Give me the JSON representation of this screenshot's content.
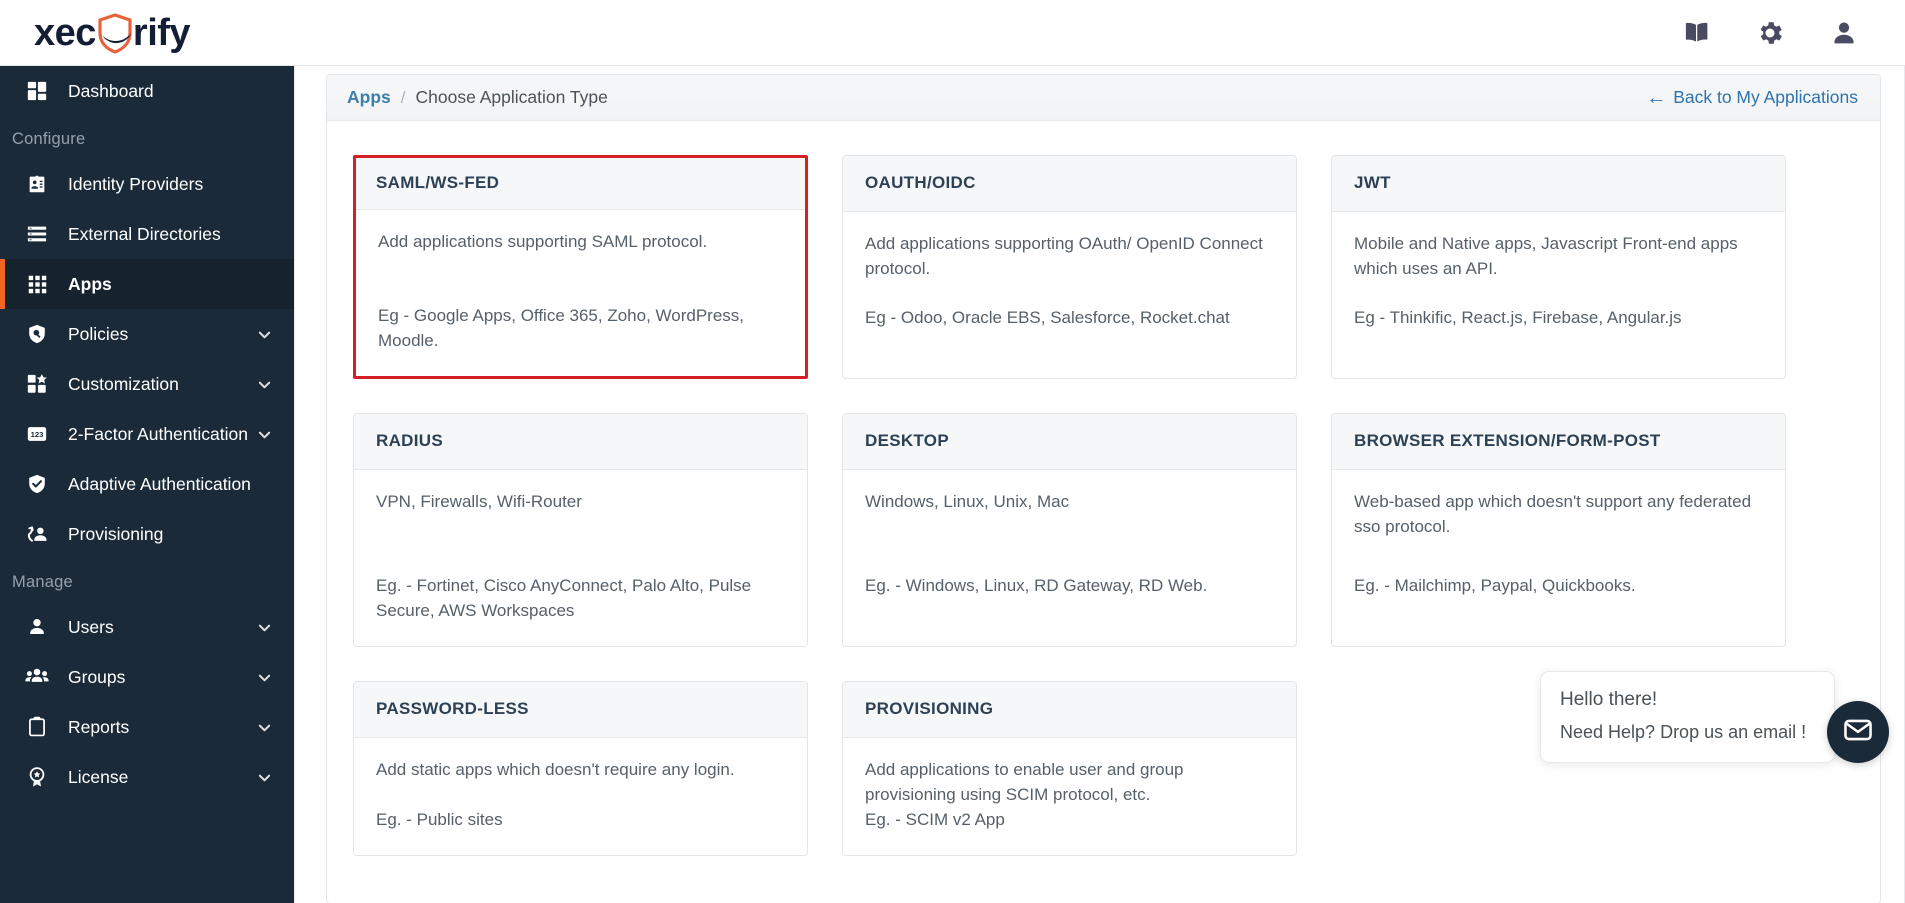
{
  "brand": {
    "name_before": "xec",
    "name_after": "rify",
    "logo_icon": "xecurify-shield-logo"
  },
  "topbar": {
    "icons": [
      {
        "name": "docs-book-icon",
        "glyph": "book"
      },
      {
        "name": "settings-gear-icon",
        "glyph": "gear"
      },
      {
        "name": "user-profile-icon",
        "glyph": "person"
      }
    ]
  },
  "sidebar": {
    "items": [
      {
        "label": "Dashboard",
        "icon": "dashboard-grid-icon",
        "active": false,
        "chevron": false,
        "type": "item"
      },
      {
        "label": "Configure",
        "type": "section"
      },
      {
        "label": "Identity Providers",
        "icon": "id-card-icon",
        "active": false,
        "chevron": false,
        "type": "item"
      },
      {
        "label": "External Directories",
        "icon": "list-directory-icon",
        "active": false,
        "chevron": false,
        "type": "item"
      },
      {
        "label": "Apps",
        "icon": "apps-grid-icon",
        "active": true,
        "chevron": false,
        "type": "item"
      },
      {
        "label": "Policies",
        "icon": "policy-shield-icon",
        "active": false,
        "chevron": true,
        "type": "item"
      },
      {
        "label": "Customization",
        "icon": "customization-icon",
        "active": false,
        "chevron": true,
        "type": "item"
      },
      {
        "label": "2-Factor Authentication",
        "icon": "two-factor-123-icon",
        "active": false,
        "chevron": true,
        "type": "item"
      },
      {
        "label": "Adaptive Authentication",
        "icon": "shield-check-icon",
        "active": false,
        "chevron": false,
        "type": "item"
      },
      {
        "label": "Provisioning",
        "icon": "provisioning-sync-user-icon",
        "active": false,
        "chevron": false,
        "type": "item"
      },
      {
        "label": "Manage",
        "type": "section"
      },
      {
        "label": "Users",
        "icon": "user-icon",
        "active": false,
        "chevron": true,
        "type": "item"
      },
      {
        "label": "Groups",
        "icon": "groups-icon",
        "active": false,
        "chevron": true,
        "type": "item"
      },
      {
        "label": "Reports",
        "icon": "clipboard-reports-icon",
        "active": false,
        "chevron": true,
        "type": "item"
      },
      {
        "label": "License",
        "icon": "license-badge-icon",
        "active": false,
        "chevron": true,
        "type": "item"
      }
    ]
  },
  "breadcrumb": {
    "root": "Apps",
    "separator": "/",
    "current": "Choose Application Type",
    "back_label": "Back to My Applications",
    "back_arrow": "←"
  },
  "cards": [
    {
      "title": "SAML/WS-FED",
      "description": "Add applications supporting SAML protocol.",
      "examples": "Eg - Google Apps, Office 365, Zoho, WordPress, Moodle.",
      "selected": true
    },
    {
      "title": "OAUTH/OIDC",
      "description": "Add applications supporting OAuth/ OpenID Connect protocol.",
      "examples": "Eg - Odoo, Oracle EBS, Salesforce, Rocket.chat",
      "selected": false
    },
    {
      "title": "JWT",
      "description": "Mobile and Native apps, Javascript Front-end apps which uses an API.",
      "examples": "Eg - Thinkific, React.js, Firebase, Angular.js",
      "selected": false
    },
    {
      "title": "RADIUS",
      "description": "VPN, Firewalls, Wifi-Router",
      "examples": "Eg. - Fortinet, Cisco AnyConnect, Palo Alto, Pulse Secure, AWS Workspaces",
      "selected": false
    },
    {
      "title": "DESKTOP",
      "description": "Windows, Linux, Unix, Mac",
      "examples": "Eg. - Windows, Linux, RD Gateway, RD Web.",
      "selected": false
    },
    {
      "title": "BROWSER EXTENSION/FORM-POST",
      "description": "Web-based app which doesn't support any federated sso protocol.",
      "examples": "Eg. - Mailchimp, Paypal, Quickbooks.",
      "selected": false
    },
    {
      "title": "PASSWORD-LESS",
      "description": "Add static apps which doesn't require any login.",
      "examples": "Eg. - Public sites",
      "selected": false
    },
    {
      "title": "PROVISIONING",
      "description": "Add applications to enable user and group provisioning using SCIM protocol, etc.",
      "examples": "Eg. - SCIM v2 App",
      "selected": false
    }
  ],
  "chat": {
    "greeting": "Hello there!",
    "prompt": "Need Help? Drop us an email !",
    "button_icon": "email-envelope-icon"
  },
  "colors": {
    "sidebar_bg": "#1b2a38",
    "active_accent": "#f26522",
    "selected_card_border": "#d32027",
    "link_blue": "#2f72b0",
    "crumb_link": "#3d7fa6",
    "card_title": "#2d4156",
    "body_text": "#56606a",
    "brand_dark": "#131d36",
    "brand_orange": "#e8623c"
  }
}
